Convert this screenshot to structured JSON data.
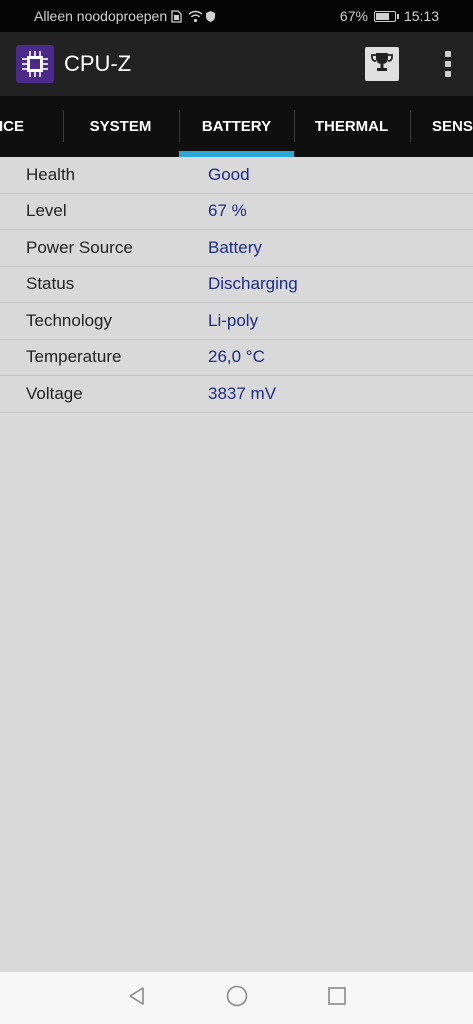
{
  "status_bar": {
    "carrier_text": "Alleen noodoproepen",
    "battery_percent_text": "67%",
    "battery_level": 0.67,
    "time": "15:13"
  },
  "app_bar": {
    "title": "CPU-Z",
    "logo_color": "#4b2a8c",
    "icons": [
      "cpu-chip-icon",
      "trophy-icon",
      "overflow-menu-icon"
    ]
  },
  "tabs": {
    "items": [
      {
        "label": "VICE"
      },
      {
        "label": "SYSTEM"
      },
      {
        "label": "BATTERY"
      },
      {
        "label": "THERMAL"
      },
      {
        "label": "SENSORS"
      }
    ],
    "active": "BATTERY",
    "indicator_color": "#2ba8d6"
  },
  "battery_info": {
    "rows": [
      {
        "label": "Health",
        "value": "Good"
      },
      {
        "label": "Level",
        "value": "67 %"
      },
      {
        "label": "Power Source",
        "value": "Battery"
      },
      {
        "label": "Status",
        "value": "Discharging"
      },
      {
        "label": "Technology",
        "value": "Li-poly"
      },
      {
        "label": "Temperature",
        "value": "26,0 °C"
      },
      {
        "label": "Voltage",
        "value": "3837 mV"
      }
    ],
    "value_color": "#1c2a8a"
  },
  "nav_bar": {
    "icons": [
      "back-icon",
      "home-icon",
      "recents-icon"
    ]
  }
}
